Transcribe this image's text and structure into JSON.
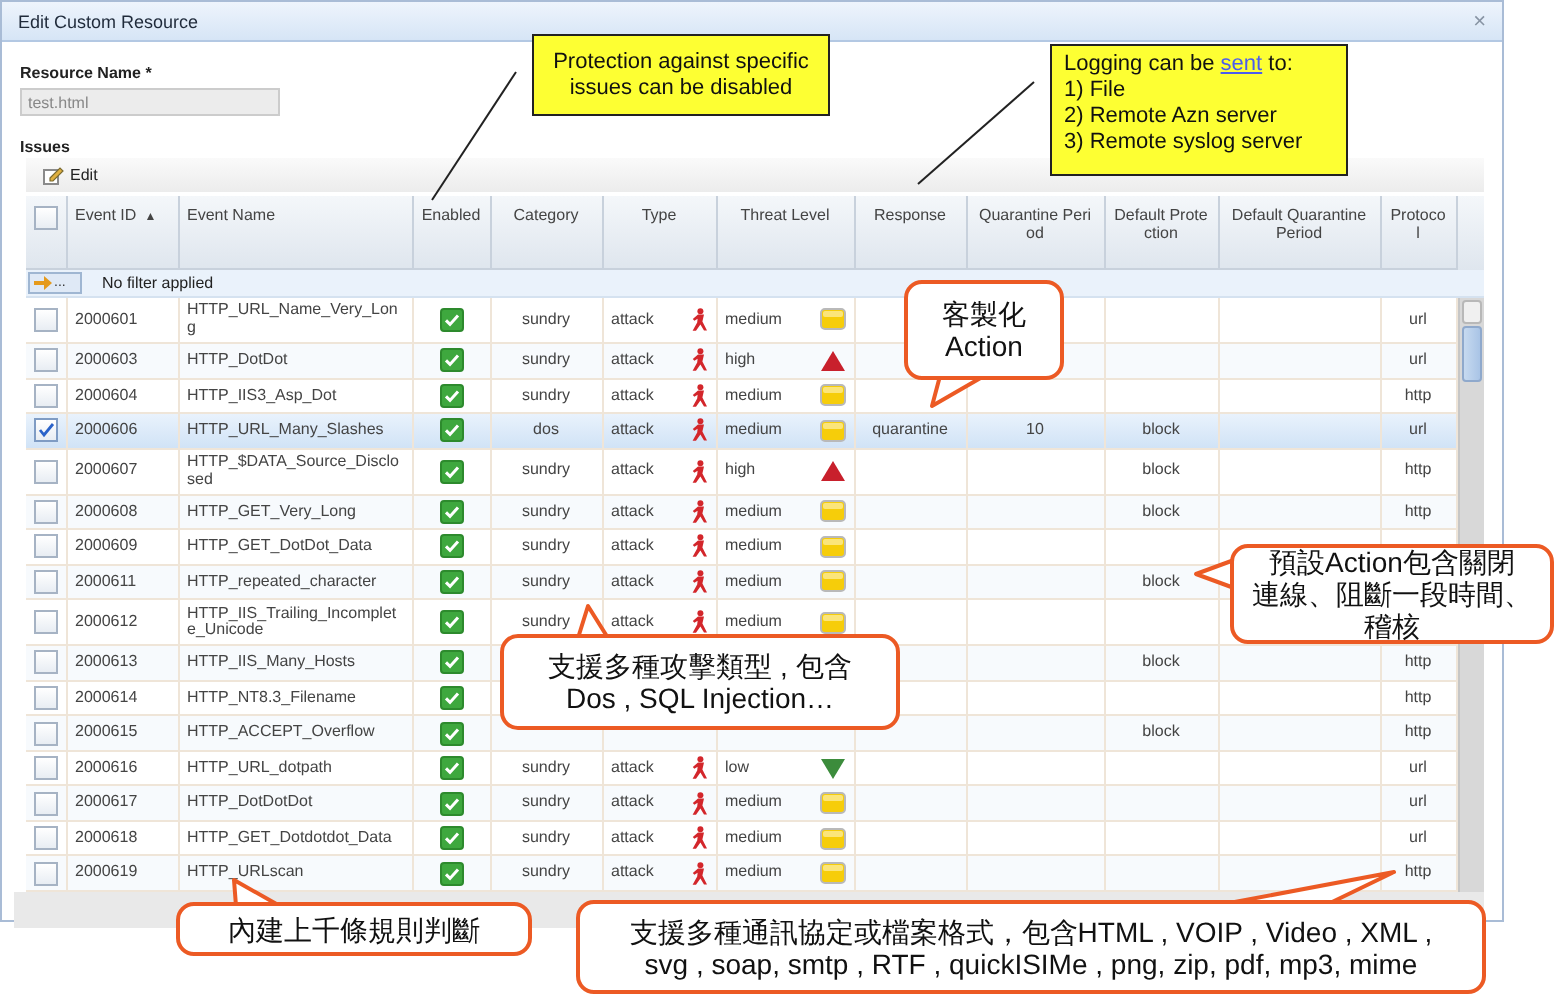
{
  "window": {
    "title": "Edit Custom Resource",
    "close": "×"
  },
  "resource_name": {
    "label": "Resource Name *",
    "value": "test.html"
  },
  "issues": {
    "label": "Issues",
    "toolbar": [
      {
        "label": "Edit"
      }
    ],
    "select_all_checked": false,
    "columns": [
      {
        "label": "Event ID",
        "sort_mark": "▲"
      },
      {
        "label": "Event Name"
      },
      {
        "label": "Enabled"
      },
      {
        "label": "Category"
      },
      {
        "label": "Type"
      },
      {
        "label": "Threat Level"
      },
      {
        "label": "Response"
      },
      {
        "label": "Quarantine Period"
      },
      {
        "label": "Default Protection"
      },
      {
        "label": "Default Quarantine Period"
      },
      {
        "label": "Protocol"
      }
    ],
    "filter": {
      "button": "...",
      "text": "No filter applied"
    },
    "rows": [
      {
        "id": "2000601",
        "name": "HTTP_URL_Name_Very_Long",
        "enabled": true,
        "category": "sundry",
        "type": "attack",
        "threat": "medium",
        "protocol": "url",
        "checked": false,
        "selected": false
      },
      {
        "id": "2000603",
        "name": "HTTP_DotDot",
        "enabled": true,
        "category": "sundry",
        "type": "attack",
        "threat": "high",
        "protocol": "url",
        "checked": false,
        "selected": false
      },
      {
        "id": "2000604",
        "name": "HTTP_IIS3_Asp_Dot",
        "enabled": true,
        "category": "sundry",
        "type": "attack",
        "threat": "medium",
        "protocol": "http",
        "checked": false,
        "selected": false
      },
      {
        "id": "2000606",
        "name": "HTTP_URL_Many_Slashes",
        "enabled": true,
        "category": "dos",
        "type": "attack",
        "threat": "medium",
        "response": "quarantine",
        "quarantine": "10",
        "default_protection": "block",
        "protocol": "url",
        "checked": true,
        "selected": true
      },
      {
        "id": "2000607",
        "name": "HTTP_$DATA_Source_Disclosed",
        "enabled": true,
        "category": "sundry",
        "type": "attack",
        "threat": "high",
        "default_protection": "block",
        "protocol": "http",
        "checked": false,
        "selected": false
      },
      {
        "id": "2000608",
        "name": "HTTP_GET_Very_Long",
        "enabled": true,
        "category": "sundry",
        "type": "attack",
        "threat": "medium",
        "default_protection": "block",
        "protocol": "http",
        "checked": false,
        "selected": false
      },
      {
        "id": "2000609",
        "name": "HTTP_GET_DotDot_Data",
        "enabled": true,
        "category": "sundry",
        "type": "attack",
        "threat": "medium",
        "checked": false,
        "selected": false
      },
      {
        "id": "2000611",
        "name": "HTTP_repeated_character",
        "enabled": true,
        "category": "sundry",
        "type": "attack",
        "threat": "medium",
        "default_protection": "block",
        "checked": false,
        "selected": false
      },
      {
        "id": "2000612",
        "name": "HTTP_IIS_Trailing_Incomplete_Unicode",
        "enabled": true,
        "category": "sundry",
        "type": "attack",
        "threat": "medium",
        "checked": false,
        "selected": false
      },
      {
        "id": "2000613",
        "name": "HTTP_IIS_Many_Hosts",
        "enabled": true,
        "default_protection": "block",
        "protocol": "http",
        "checked": false,
        "selected": false
      },
      {
        "id": "2000614",
        "name": "HTTP_NT8.3_Filename",
        "enabled": true,
        "protocol": "http",
        "checked": false,
        "selected": false
      },
      {
        "id": "2000615",
        "name": "HTTP_ACCEPT_Overflow",
        "enabled": true,
        "default_protection": "block",
        "protocol": "http",
        "checked": false,
        "selected": false
      },
      {
        "id": "2000616",
        "name": "HTTP_URL_dotpath",
        "enabled": true,
        "category": "sundry",
        "type": "attack",
        "threat": "low",
        "protocol": "url",
        "checked": false,
        "selected": false
      },
      {
        "id": "2000617",
        "name": "HTTP_DotDotDot",
        "enabled": true,
        "category": "sundry",
        "type": "attack",
        "threat": "medium",
        "protocol": "url",
        "checked": false,
        "selected": false
      },
      {
        "id": "2000618",
        "name": "HTTP_GET_Dotdotdot_Data",
        "enabled": true,
        "category": "sundry",
        "type": "attack",
        "threat": "medium",
        "protocol": "url",
        "checked": false,
        "selected": false
      },
      {
        "id": "2000619",
        "name": "HTTP_URLscan",
        "enabled": true,
        "category": "sundry",
        "type": "attack",
        "threat": "medium",
        "protocol": "http",
        "checked": false,
        "selected": false
      }
    ]
  },
  "callouts": [
    {
      "kind": "note",
      "text": "Protection against specific issues can be disabled"
    },
    {
      "kind": "note",
      "lead": "Logging can be ",
      "link": "sent",
      "tail": " to:",
      "lines": [
        "1) File",
        "2) Remote Azn server",
        "3) Remote syslog server"
      ]
    },
    {
      "kind": "bubble",
      "lines": [
        "客製化",
        "Action"
      ]
    },
    {
      "kind": "bubble",
      "lines": [
        "預設Action包含關閉",
        "連線、阻斷一段時間、",
        "稽核"
      ]
    },
    {
      "kind": "bubble",
      "lines": [
        "支援多種攻擊類型 , 包含",
        "Dos , SQL Injection…"
      ]
    },
    {
      "kind": "bubble",
      "lines": [
        "內建上千條規則判斷"
      ]
    },
    {
      "kind": "bubble",
      "lines": [
        "支援多種通訊協定或檔案格式，包含HTML , VOIP , Video , XML ,",
        "svg , soap, smtp , RTF , quickISIMe , png, zip, pdf, mp3, mime"
      ]
    }
  ]
}
